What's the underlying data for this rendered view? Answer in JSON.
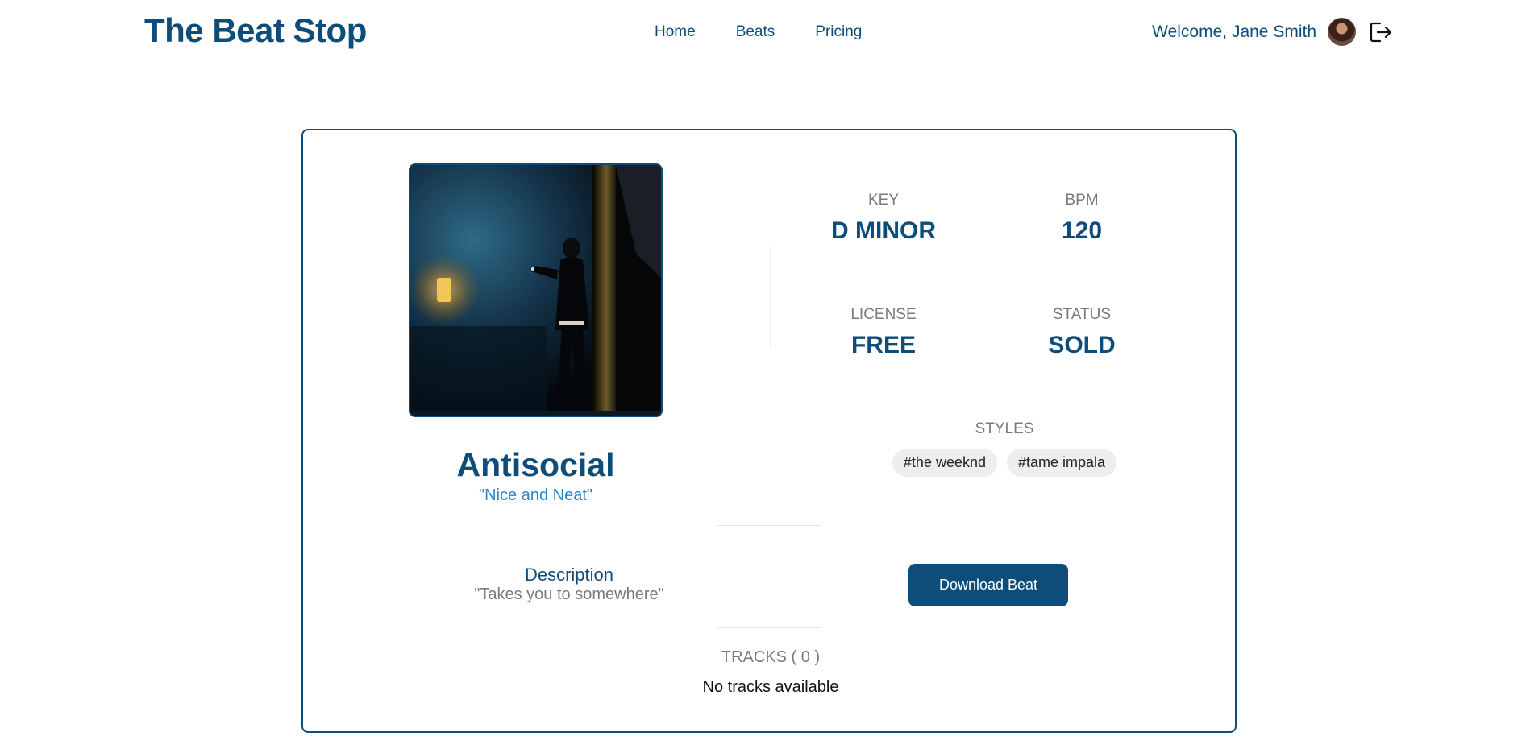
{
  "header": {
    "brand": "The Beat Stop",
    "nav": [
      {
        "label": "Home"
      },
      {
        "label": "Beats"
      },
      {
        "label": "Pricing"
      }
    ],
    "welcome": "Welcome, Jane Smith"
  },
  "beat": {
    "title": "Antisocial",
    "subtitle": "\"Nice and Neat\"",
    "meta": {
      "key_label": "KEY",
      "key_value": "D MINOR",
      "bpm_label": "BPM",
      "bpm_value": "120",
      "license_label": "LICENSE",
      "license_value": "FREE",
      "status_label": "STATUS",
      "status_value": "SOLD"
    },
    "styles_label": "STYLES",
    "styles": [
      {
        "label": "#the weeknd"
      },
      {
        "label": "#tame impala"
      }
    ],
    "description_title": "Description",
    "description_text": "\"Takes you to somewhere\"",
    "download_label": "Download Beat",
    "tracks_label": "TRACKS ( 0 )",
    "tracks_empty": "No tracks available"
  },
  "colors": {
    "primary": "#0e4c79",
    "accent_text": "#2b86c5",
    "muted": "#7a7a7a",
    "tag_bg": "#eeeeee"
  },
  "icons": {
    "logout": "logout-icon",
    "avatar": "avatar"
  }
}
